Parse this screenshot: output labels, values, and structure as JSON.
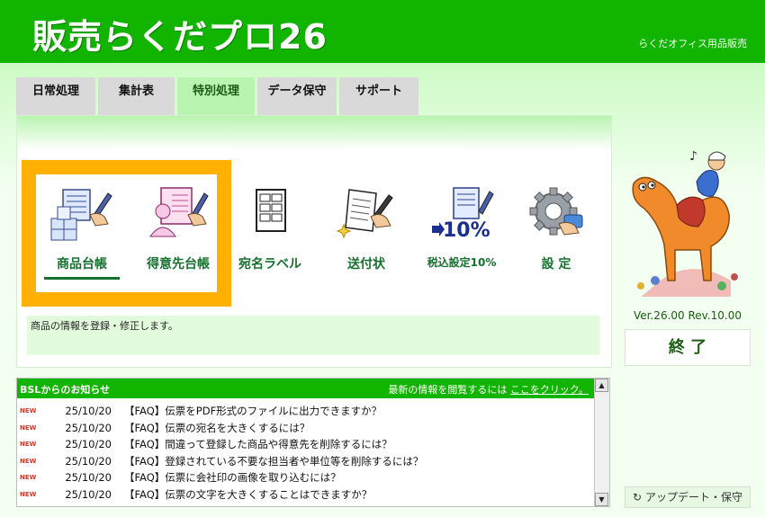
{
  "header": {
    "app_title": "販売らくだプロ26",
    "vendor": "らくだオフィス用品販売"
  },
  "tabs": [
    {
      "label": "日常処理"
    },
    {
      "label": "集計表"
    },
    {
      "label": "特別処理",
      "active": true
    },
    {
      "label": "データ保守"
    },
    {
      "label": "サポート"
    }
  ],
  "functions": [
    {
      "label": "商品台帳",
      "icon": "product-ledger-icon",
      "selected": true
    },
    {
      "label": "得意先台帳",
      "icon": "customer-ledger-icon"
    },
    {
      "label": "宛名ラベル",
      "icon": "address-label-icon"
    },
    {
      "label": "送付状",
      "icon": "cover-letter-icon"
    },
    {
      "label": "税込設定10%",
      "icon": "tax-setting-icon"
    },
    {
      "label": "設 定",
      "icon": "settings-gear-icon"
    }
  ],
  "description": "商品の情報を登録・修正します。",
  "side": {
    "version": "Ver.26.00 Rev.10.00",
    "exit_label": "終 了",
    "update_label": "アップデート・保守",
    "illustration": "camel-mascot"
  },
  "news": {
    "title": "BSLからのお知らせ",
    "link_prefix": "最新の情報を閲覧するには",
    "link_text": "ここをクリック。",
    "items": [
      {
        "badge": "NEW",
        "date": "25/10/20",
        "text": "【FAQ】伝票をPDF形式のファイルに出力できますか？"
      },
      {
        "badge": "NEW",
        "date": "25/10/20",
        "text": "【FAQ】伝票の宛名を大きくするには？"
      },
      {
        "badge": "NEW",
        "date": "25/10/20",
        "text": "【FAQ】間違って登録した商品や得意先を削除するには？"
      },
      {
        "badge": "NEW",
        "date": "25/10/20",
        "text": "【FAQ】登録されている不要な担当者や単位等を削除するには？"
      },
      {
        "badge": "NEW",
        "date": "25/10/20",
        "text": "【FAQ】伝票に会社印の画像を取り込むには？"
      },
      {
        "badge": "NEW",
        "date": "25/10/20",
        "text": "【FAQ】伝票の文字を大きくすることはできますか？"
      }
    ]
  },
  "colors": {
    "brand_green": "#11b500",
    "accent_orange": "#ffb000",
    "label_green": "#15712d",
    "new_red": "#e8311e"
  }
}
